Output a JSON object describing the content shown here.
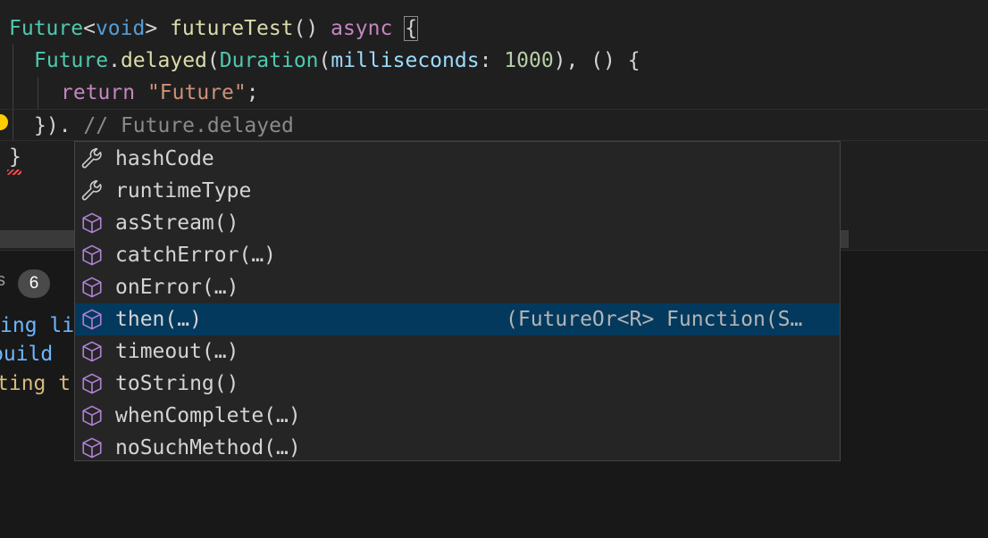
{
  "code": {
    "line1": {
      "type": "Future",
      "lt": "<",
      "generic": "void",
      "gt": ">",
      "name": "futureTest",
      "parens": "()",
      "async": "async",
      "brace": "{"
    },
    "line2": {
      "cls": "Future",
      "dot": ".",
      "method": "delayed",
      "open": "(",
      "dur": "Duration",
      "open2": "(",
      "param": "milliseconds",
      "colon": ":",
      "value": "1000",
      "rest": "), () {"
    },
    "line3": {
      "kw": "return",
      "str": "\"Future\"",
      "semi": ";"
    },
    "line4": {
      "code": "}).",
      "comment": "// Future.delayed"
    },
    "line5": {
      "brace": "}"
    }
  },
  "panel": {
    "badge_prefix": "s",
    "badge_count": "6",
    "lines": [
      "ing li",
      "build",
      "ting t"
    ]
  },
  "suggest": {
    "items": [
      {
        "label": "hashCode",
        "kind": "wrench-icon",
        "detail": ""
      },
      {
        "label": "runtimeType",
        "kind": "wrench-icon",
        "detail": ""
      },
      {
        "label": "asStream()",
        "kind": "cube-icon",
        "detail": ""
      },
      {
        "label": "catchError(…)",
        "kind": "cube-icon",
        "detail": ""
      },
      {
        "label": "onError(…)",
        "kind": "cube-icon",
        "detail": ""
      },
      {
        "label": "then(…)",
        "kind": "cube-icon",
        "detail": "(FutureOr<R> Function(S…",
        "selected": true
      },
      {
        "label": "timeout(…)",
        "kind": "cube-icon",
        "detail": ""
      },
      {
        "label": "toString()",
        "kind": "cube-icon",
        "detail": ""
      },
      {
        "label": "whenComplete(…)",
        "kind": "cube-icon",
        "detail": ""
      },
      {
        "label": "noSuchMethod(…)",
        "kind": "cube-icon",
        "detail": ""
      }
    ],
    "colors": {
      "method_icon": "#b180d7",
      "field_icon": "#cccccc",
      "selected_bg": "#04395e"
    }
  }
}
